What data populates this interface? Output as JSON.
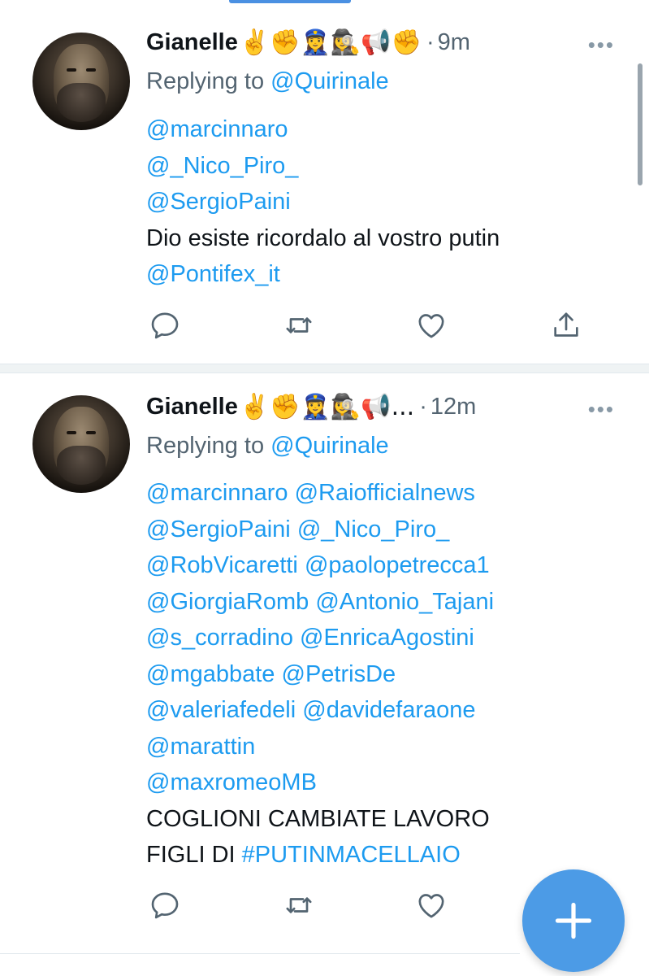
{
  "tweets": [
    {
      "author": "Gianelle",
      "emoji": "✌️✊👮‍♀️🕵️‍♀️📢✊",
      "separator": "·",
      "time": "9m",
      "more": "•••",
      "replying_prefix": "Replying to",
      "replying_handle": "@Quirinale",
      "mentions": [
        "@marcinnaro",
        "@_Nico_Piro_",
        "@SergioPaini"
      ],
      "text": "Dio esiste ricordalo al vostro putin",
      "trailing_mention": "@Pontifex_it",
      "actions": {
        "reply": "reply-icon",
        "retweet": "retweet-icon",
        "like": "heart-icon",
        "share": "share-icon"
      }
    },
    {
      "author": "Gianelle",
      "emoji": "✌️✊👮‍♀️🕵️‍♀️📢...",
      "separator": "·",
      "time": "12m",
      "more": "•••",
      "replying_prefix": "Replying to",
      "replying_handle": "@Quirinale",
      "mention_lines": [
        [
          "@marcinnaro",
          "@Raiofficialnews"
        ],
        [
          "@SergioPaini",
          "@_Nico_Piro_"
        ],
        [
          "@RobVicaretti",
          "@paolopetrecca1"
        ],
        [
          "@GiorgiaRomb",
          "@Antonio_Tajani"
        ],
        [
          "@s_corradino",
          "@EnricaAgostini"
        ],
        [
          "@mgabbate",
          "@PetrisDe"
        ],
        [
          "@valeriafedeli",
          "@davidefaraone"
        ],
        [
          "@marattin"
        ],
        [
          "@maxromeoMB"
        ]
      ],
      "text_line1": "COGLIONI CAMBIATE LAVORO",
      "text_line2_prefix": "FIGLI DI",
      "hashtag": "#PUTINMACELLAIO",
      "actions": {
        "reply": "reply-icon",
        "retweet": "retweet-icon",
        "like": "heart-icon"
      }
    }
  ],
  "fab": {
    "icon": "plus-icon",
    "color": "#4c9be6"
  },
  "colors": {
    "link": "#1d9bf0",
    "muted": "#536471",
    "text": "#0f1419"
  }
}
